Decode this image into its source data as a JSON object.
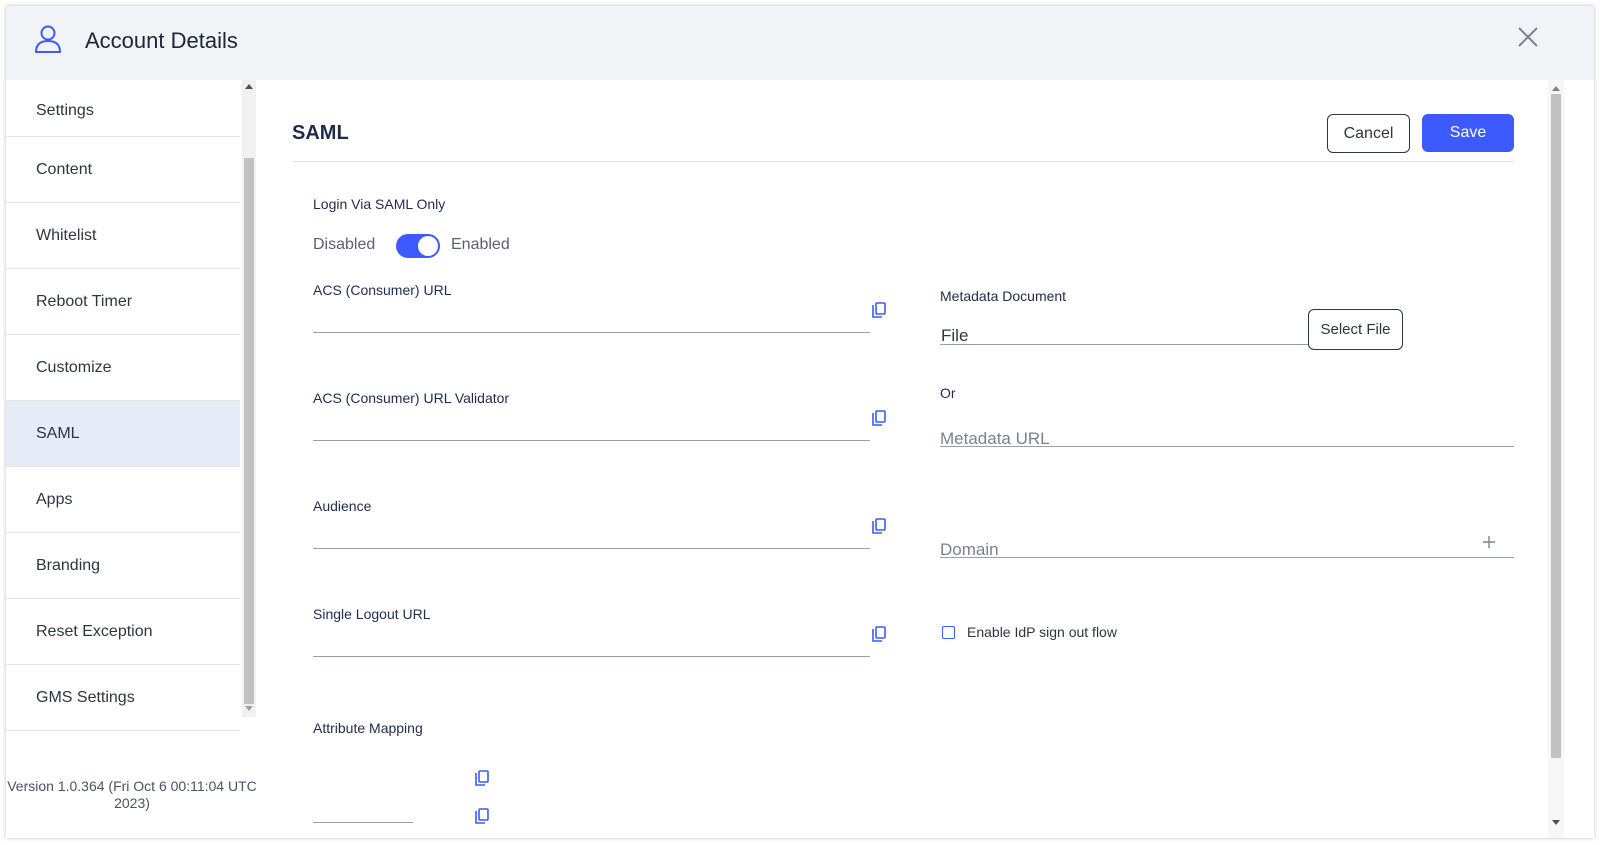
{
  "header": {
    "title": "Account Details"
  },
  "sidebar": {
    "items": [
      {
        "label": "Settings"
      },
      {
        "label": "Content"
      },
      {
        "label": "Whitelist"
      },
      {
        "label": "Reboot Timer"
      },
      {
        "label": "Customize"
      },
      {
        "label": "SAML",
        "active": true
      },
      {
        "label": "Apps"
      },
      {
        "label": "Branding"
      },
      {
        "label": "Reset Exception"
      },
      {
        "label": "GMS Settings"
      }
    ],
    "version_line1": "Version 1.0.364 (Fri Oct 6 00:11:04 UTC",
    "version_line2": "2023)"
  },
  "main": {
    "title": "SAML",
    "cancel_label": "Cancel",
    "save_label": "Save",
    "login_saml": {
      "label": "Login Via SAML Only",
      "off_label": "Disabled",
      "on_label": "Enabled",
      "enabled": true
    },
    "fields": {
      "acs_url_label": "ACS (Consumer) URL",
      "acs_validator_label": "ACS (Consumer) URL Validator",
      "audience_label": "Audience",
      "logout_label": "Single Logout URL",
      "attribute_mapping_label": "Attribute Mapping"
    },
    "metadata": {
      "doc_label": "Metadata Document",
      "file_value": "File",
      "select_file_label": "Select File",
      "or_label": "Or",
      "url_placeholder": "Metadata URL"
    },
    "domain_placeholder": "Domain",
    "idp_signout_label": "Enable IdP sign out flow",
    "idp_signout_checked": false
  },
  "colors": {
    "accent": "#3d5afe",
    "active_nav_bg": "#e6ebf8"
  }
}
